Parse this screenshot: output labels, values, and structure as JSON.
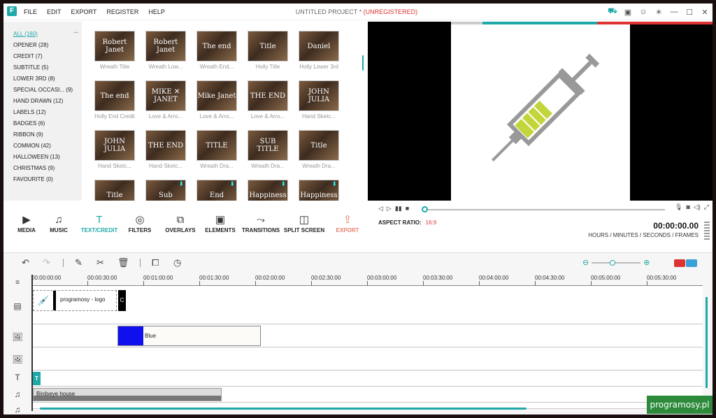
{
  "app": {
    "logo": "F",
    "menu": [
      "FILE",
      "EDIT",
      "EXPORT",
      "REGISTER",
      "HELP"
    ],
    "title": "UNTITLED PROJECT *",
    "title_status": "(UNREGISTERED)"
  },
  "categories": [
    {
      "label": "ALL (160)",
      "active": true
    },
    {
      "label": "OPENER (28)"
    },
    {
      "label": "CREDIT (7)"
    },
    {
      "label": "SUBTITLE (5)"
    },
    {
      "label": "LOWER 3RD (8)"
    },
    {
      "label": "SPECIAL OCCASI...  (9)"
    },
    {
      "label": "HAND DRAWN (12)"
    },
    {
      "label": "LABELS (12)"
    },
    {
      "label": "BADGES (6)"
    },
    {
      "label": "RIBBON (9)"
    },
    {
      "label": "COMMON (42)"
    },
    {
      "label": "HALLOWEEN (13)"
    },
    {
      "label": "CHRISTMAS (9)"
    },
    {
      "label": "FAVOURITE (0)"
    }
  ],
  "tiles": [
    {
      "name": "Wreath Title",
      "overlay": "Robert\nJanet"
    },
    {
      "name": "Wreath Low...",
      "overlay": "Robert\nJanet"
    },
    {
      "name": "Wreath End...",
      "overlay": "The\nend"
    },
    {
      "name": "Holly Title",
      "overlay": "Title"
    },
    {
      "name": "Holly Lower 3rd",
      "overlay": "Daniel"
    },
    {
      "name": "Holly End Credit",
      "overlay": "The\nend"
    },
    {
      "name": "Love & Arro...",
      "overlay": "MIKE ✕ JANET"
    },
    {
      "name": "Love & Arro...",
      "overlay": "Mike Janet"
    },
    {
      "name": "Love & Arro...",
      "overlay": "THE END"
    },
    {
      "name": "Hand Sketc...",
      "overlay": "JOHN JULIA"
    },
    {
      "name": "Hand Sketc...",
      "overlay": "JOHN JULIA"
    },
    {
      "name": "Hand Sketc...",
      "overlay": "THE END"
    },
    {
      "name": "Wreath Dra...",
      "overlay": "TITLE"
    },
    {
      "name": "Wreath Dra...",
      "overlay": "SUB TITLE"
    },
    {
      "name": "Wreath Dra...",
      "overlay": "Title"
    },
    {
      "name": "",
      "overlay": "Title"
    },
    {
      "name": "",
      "overlay": "Sub",
      "download": true
    },
    {
      "name": "",
      "overlay": "End",
      "download": true
    },
    {
      "name": "",
      "overlay": "Happiness",
      "download": true
    },
    {
      "name": "",
      "overlay": "Happiness",
      "download": true
    }
  ],
  "toolbar": [
    {
      "label": "MEDIA",
      "icon": "media-icon",
      "glyph": "▶"
    },
    {
      "label": "MUSIC",
      "icon": "music-icon",
      "glyph": "♫"
    },
    {
      "label": "TEXT/CREDIT",
      "icon": "text-icon",
      "glyph": "T",
      "active": true
    },
    {
      "label": "FILTERS",
      "icon": "filters-icon",
      "glyph": "◎"
    },
    {
      "label": "OVERLAYS",
      "icon": "overlays-icon",
      "glyph": "⧉"
    },
    {
      "label": "ELEMENTS",
      "icon": "elements-icon",
      "glyph": "▣"
    },
    {
      "label": "TRANSITIONS",
      "icon": "transitions-icon",
      "glyph": "⤳"
    },
    {
      "label": "SPLIT SCREEN",
      "icon": "split-screen-icon",
      "glyph": "◫"
    },
    {
      "label": "EXPORT",
      "icon": "export-icon",
      "glyph": "⇪",
      "export": true
    }
  ],
  "player": {
    "aspect_label": "ASPECT RATIO:",
    "aspect_value": "16:9",
    "timecode": "00:00:00.00",
    "timecode_label": "HOURS / MINUTES / SECONDS / FRAMES",
    "position_fraction": 0
  },
  "ruler": [
    "00:00:00:00",
    "00:00:30:00",
    "00:01:00:00",
    "00:01:30:00",
    "00:02:00:00",
    "00:02:30:00",
    "00:03:00:00",
    "00:03:30:00",
    "00:04:00:00",
    "00:04:30:00",
    "00:05:00:00",
    "00:05:30:00"
  ],
  "clips": {
    "video1": "programosy - logo",
    "video1_short": "C",
    "pip1": "Blue",
    "text": "T",
    "audio": "Birdseye house"
  },
  "watermark": "programosy.pl",
  "colors": {
    "accent": "#1fa8a8",
    "warn": "#dd3333",
    "export": "#e8806a"
  }
}
